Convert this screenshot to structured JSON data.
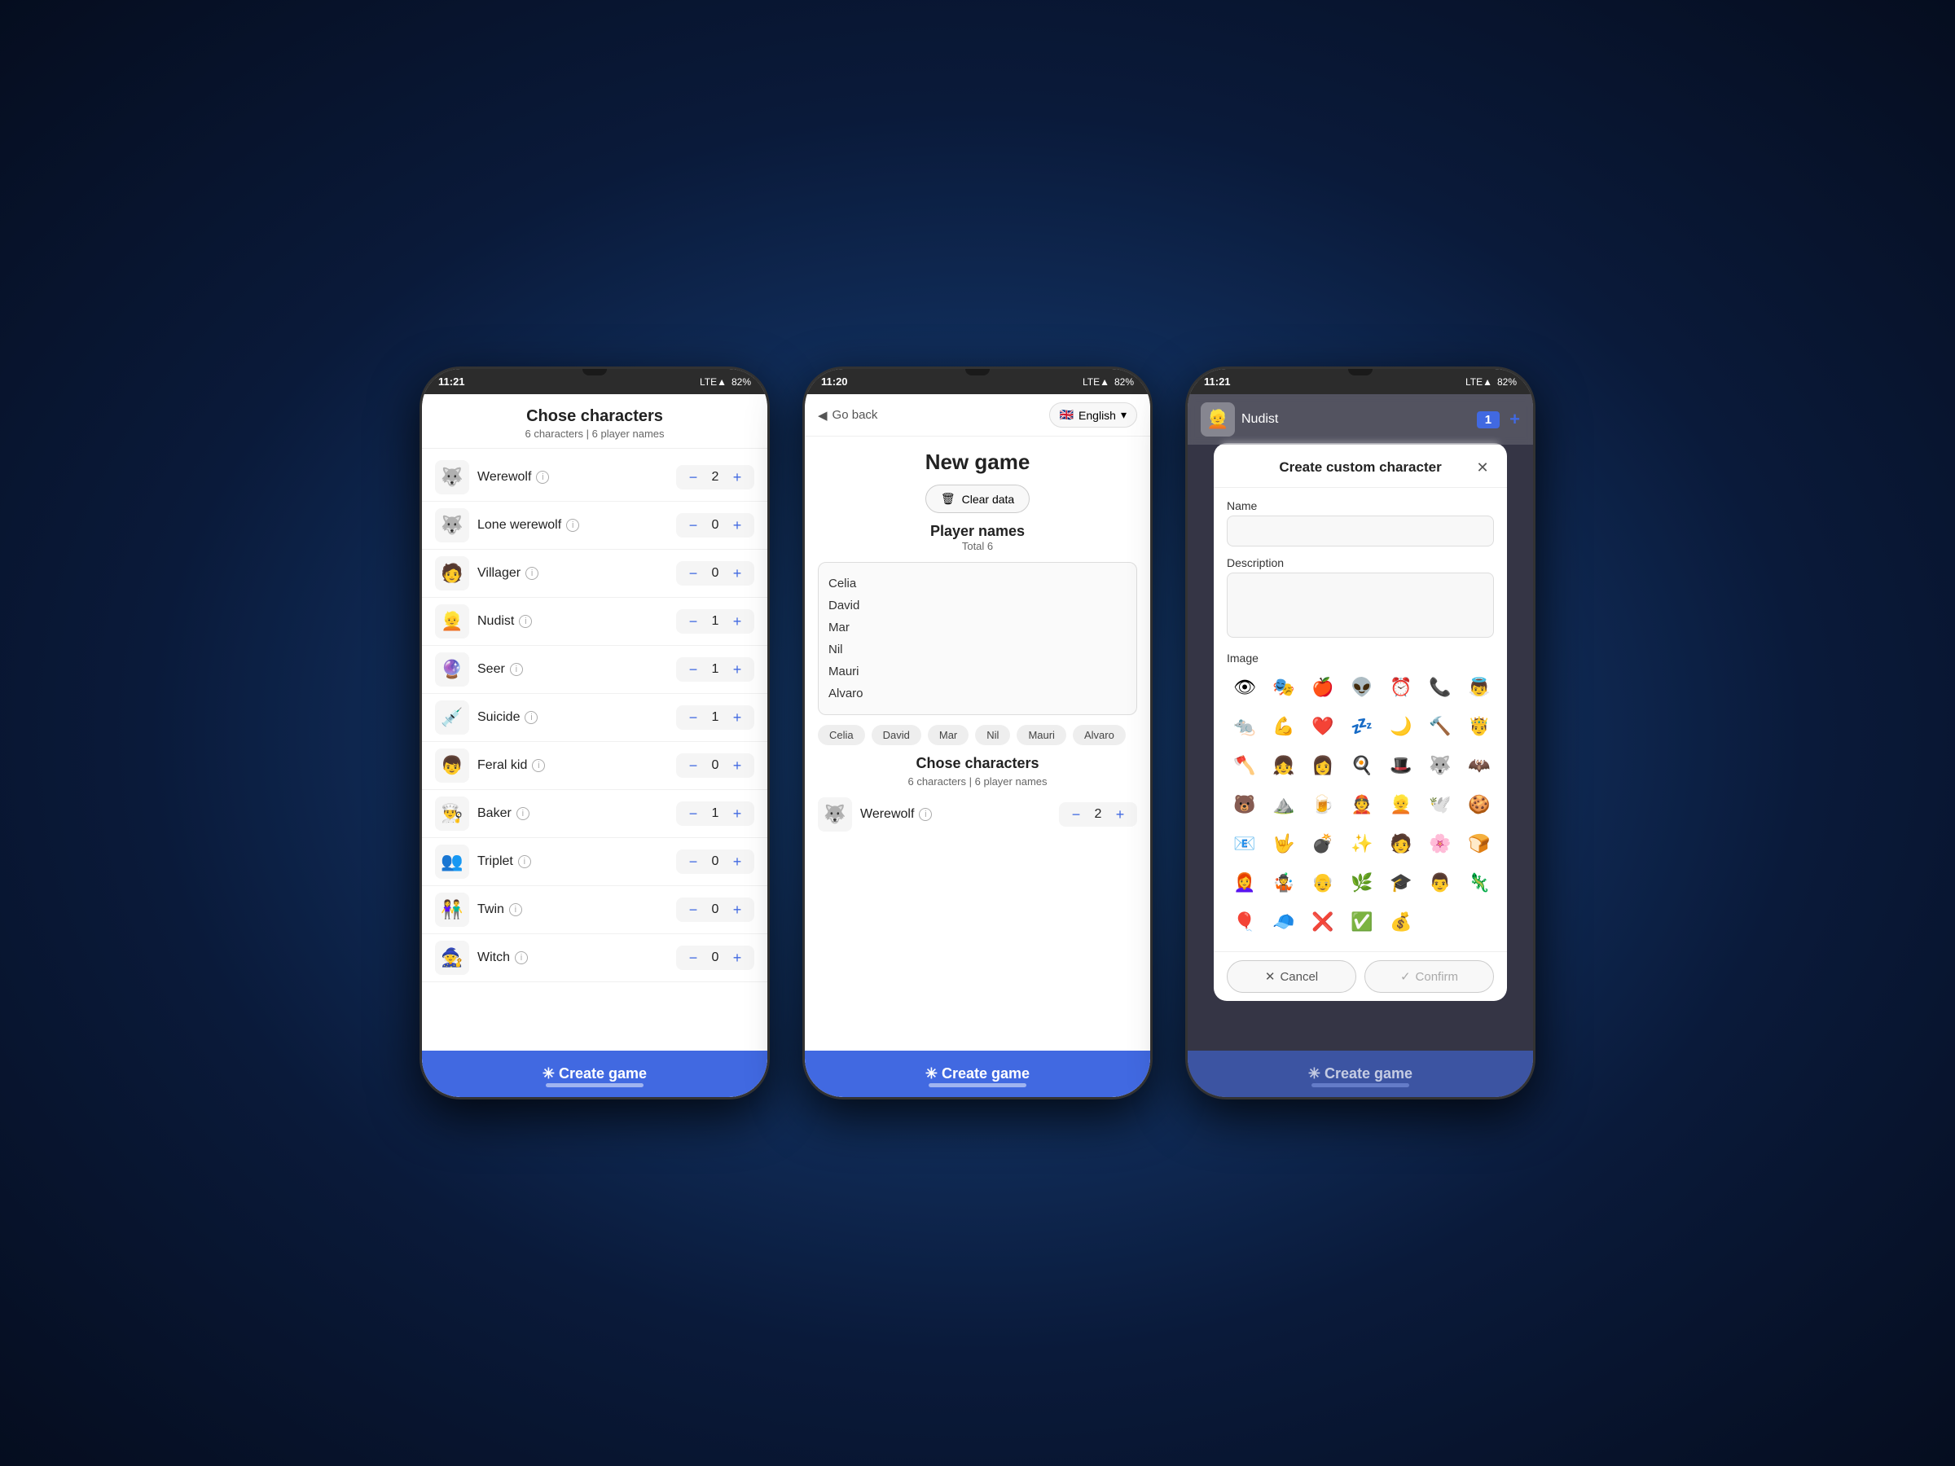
{
  "status": {
    "time1": "11:21",
    "time2": "11:20",
    "time3": "11:21",
    "signal": "LTE",
    "battery": "82%"
  },
  "phone1": {
    "header": {
      "title": "Chose characters",
      "subtitle": "6 characters | 6 player names"
    },
    "characters": [
      {
        "name": "Werewolf",
        "icon": "🐺",
        "count": 2
      },
      {
        "name": "Lone werewolf",
        "icon": "🐺",
        "count": 0
      },
      {
        "name": "Villager",
        "icon": "🧑",
        "count": 0
      },
      {
        "name": "Nudist",
        "icon": "👱",
        "count": 1
      },
      {
        "name": "Seer",
        "icon": "🔮",
        "count": 1
      },
      {
        "name": "Suicide",
        "icon": "💉",
        "count": 1
      },
      {
        "name": "Feral kid",
        "icon": "👦",
        "count": 0
      },
      {
        "name": "Baker",
        "icon": "👨‍🍳",
        "count": 1
      },
      {
        "name": "Triplet",
        "icon": "👥",
        "count": 0
      },
      {
        "name": "Twin",
        "icon": "👫",
        "count": 0
      },
      {
        "name": "Witch",
        "icon": "🧙",
        "count": 0
      }
    ],
    "create_btn": "✳ Create game"
  },
  "phone2": {
    "back_label": "Go back",
    "language": "English",
    "title": "New game",
    "clear_label": "Clear data",
    "players": {
      "title": "Player names",
      "total": "Total 6",
      "names": [
        "Celia",
        "David",
        "Mar",
        "Nil",
        "Mauri",
        "Alvaro"
      ]
    },
    "characters": {
      "title": "Chose characters",
      "subtitle": "6 characters | 6 player names"
    },
    "werewolf": {
      "name": "Werewolf",
      "count": 2
    },
    "create_btn": "✳ Create game"
  },
  "phone3": {
    "nudist_label": "Nudist",
    "count": "1",
    "modal": {
      "title": "Create custom character",
      "name_label": "Name",
      "name_placeholder": "",
      "description_label": "Description",
      "image_label": "Image",
      "emojis": [
        "👁",
        "🎭",
        "🍎",
        "👽",
        "⏰",
        "📞",
        "👼",
        "🐀",
        "💪",
        "❤️",
        "💤",
        "🌙",
        "🔨",
        "🤴",
        "🪓",
        "👧",
        "👩",
        "🍳",
        "🎩",
        "🐺",
        "🦇",
        "🐻",
        "⛰️",
        "🍺",
        "👲",
        "👱",
        "🕊️",
        "🍪",
        "📧",
        "🤟",
        "💣",
        "✨",
        "🧑",
        "🌸",
        "🍞",
        "👩‍🦰",
        "🤹",
        "👴",
        "🌿",
        "🎓",
        "👨",
        "🦎",
        "🎈",
        "🧢",
        "❌",
        "✅",
        "💰"
      ],
      "cancel_label": "Cancel",
      "confirm_label": "Confirm"
    },
    "create_btn": "✳ Create game"
  }
}
